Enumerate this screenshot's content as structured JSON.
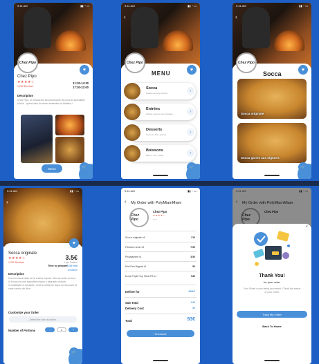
{
  "status_time": "9:41 AM",
  "restaurant": {
    "name": "Chez Pipo",
    "reviews": "1,250 Reviews",
    "hours_1": "11:30-14:30",
    "hours_2": "17:30-22:00",
    "description_label": "Description",
    "description_text": "Chez Pipo, un restaurant incontournable de pizza et spécialités à Nice : quand faim de rester ensemble la tradition !",
    "logo_text": "Chez Pipo",
    "menu_button": "Menu"
  },
  "menu_screen": {
    "heading": "MENU",
    "items": [
      {
        "name": "Socca",
        "desc": "Galette de pois chiches"
      },
      {
        "name": "Entrées",
        "desc": "Petites entrées pour partager"
      },
      {
        "name": "Desserts",
        "desc": "Sucré de Nice, glaces"
      },
      {
        "name": "Boissons",
        "desc": "Bières, vins, sodas"
      }
    ]
  },
  "socca_screen": {
    "heading": "Socca",
    "items": [
      "Socca originale",
      "Socca garnie aux oignons"
    ]
  },
  "product_screen": {
    "name": "Socca originale",
    "reviews": "1,250 Reviews",
    "price": "3.5€",
    "price_note": "1 per Portion",
    "time_label": "Time to prepare",
    "time_value": "5-10 min",
    "kcal": "Available",
    "description_label": "Description",
    "description_text": "Une incontournable de la cuisine niçoise. Dès sa sortie du four, la Socca est une spécialité unique à déguster chaude. Croustillante et fondante, c'est la meilleure façon de découvrir la vraie saveur de Nice.",
    "customize_label": "Customize your Order",
    "select_placeholder": "-- Select the size of portion --",
    "portions_label": "Number of Portions",
    "minus": "-",
    "qty": "1",
    "plus": "+"
  },
  "order_screen": {
    "title": "My Order with PolyMiamMiam",
    "restaurant": "Chez Pipo",
    "lines": [
      {
        "name": "Socca originale x6",
        "price": "21€"
      },
      {
        "name": "Panisse ronde x3",
        "price": "7.5€"
      },
      {
        "name": "Pissaladière x1",
        "price": "3.5€"
      },
      {
        "name": "Mini Pan Bagnat x2",
        "price": "5€"
      },
      {
        "name": "Duval Triple Hop Citra IPA x1",
        "price": "54€"
      }
    ],
    "deliver_for_label": "Deliver for",
    "deliver_for_value": "ASAP",
    "subtotal_label": "Sub Total",
    "subtotal_value": "91€",
    "delivery_label": "Delivery Cost",
    "delivery_value": "2€",
    "total_label": "Total",
    "total_value": "93€",
    "checkout": "Checkout"
  },
  "thanks_screen": {
    "title": "Thank You!",
    "subtitle": "for your order",
    "message": "Your Order is now being processed. Check the status of your Order.",
    "track": "Track My Order",
    "back_home": "Back To Home",
    "close": "×"
  },
  "colors": {
    "accent": "#4a90d9",
    "background": "#1d5fc4",
    "stars": "#e74c3c"
  }
}
